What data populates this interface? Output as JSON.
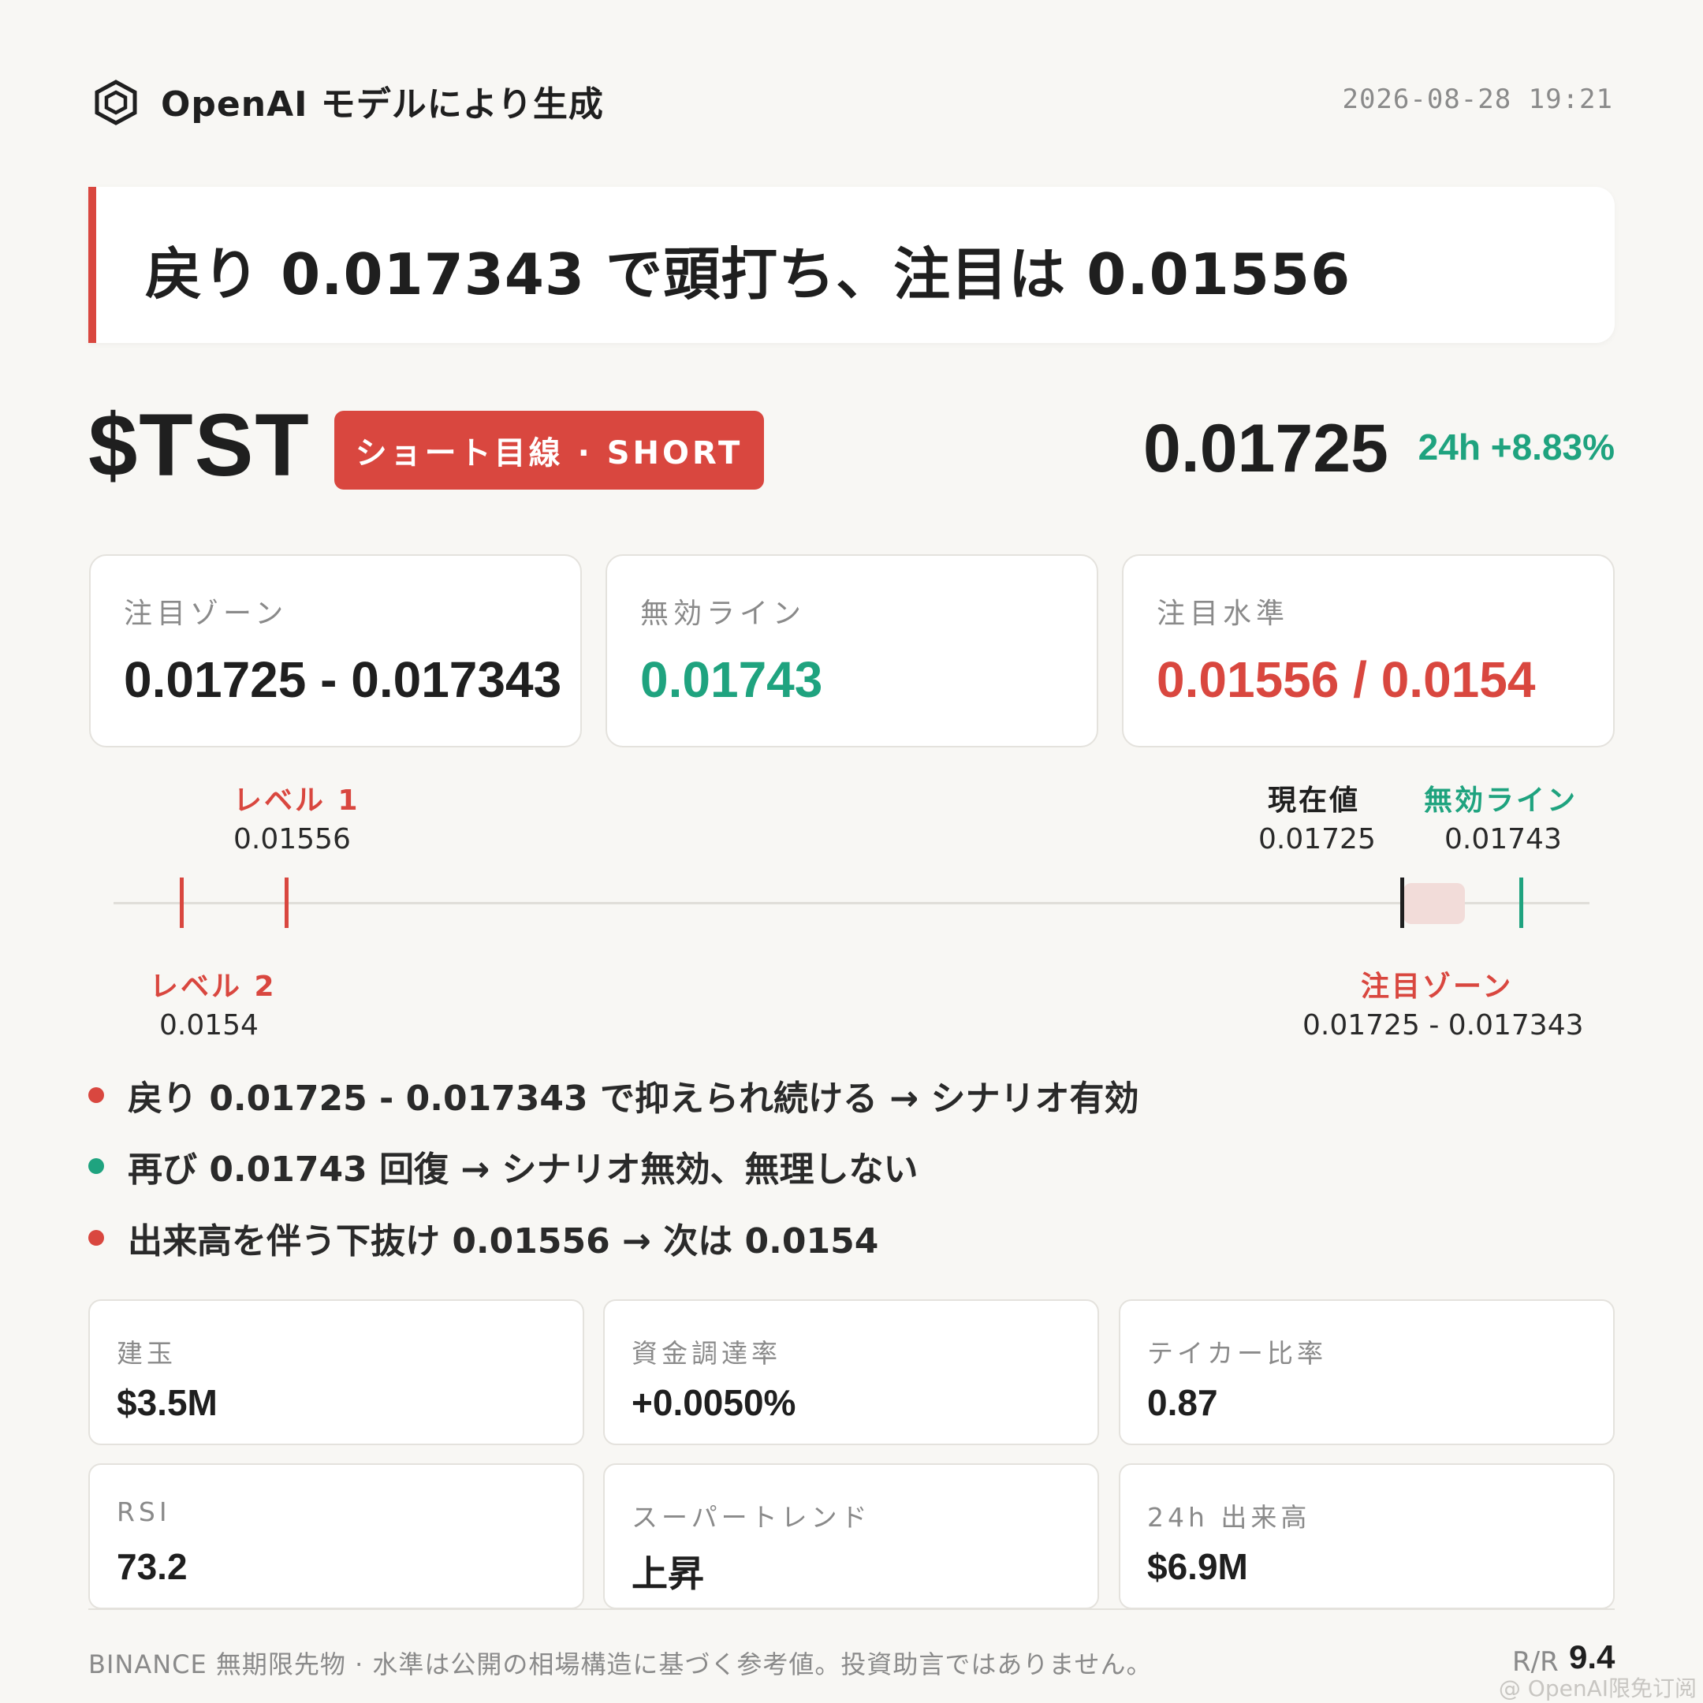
{
  "header": {
    "logo_icon": "openai-hexagon-icon",
    "title": "OpenAI モデルにより生成",
    "timestamp": "2026-08-28 19:21"
  },
  "headline": "戻り 0.017343 で頭打ち、注目は 0.01556",
  "ticker": {
    "symbol": "$TST",
    "badge": "ショート目線 · SHORT",
    "price": "0.01725",
    "change_24h": "24h +8.83%"
  },
  "level_cards": [
    {
      "label": "注目ゾーン",
      "value": "0.01725 - 0.017343",
      "color": "#1f1f1f"
    },
    {
      "label": "無効ライン",
      "value": "0.01743",
      "color": "#1fa37f"
    },
    {
      "label": "注目水準",
      "value": "0.01556 / 0.0154",
      "color": "#d9473f"
    }
  ],
  "ladder": {
    "level1": {
      "label": "レベル 1",
      "value": "0.01556"
    },
    "level2": {
      "label": "レベル 2",
      "value": "0.0154"
    },
    "current": {
      "label": "現在値",
      "value": "0.01725"
    },
    "invalid": {
      "label": "無効ライン",
      "value": "0.01743"
    },
    "zone": {
      "label": "注目ゾーン",
      "value": "0.01725 - 0.017343"
    }
  },
  "scenarios": [
    {
      "text": "戻り 0.01725 - 0.017343 で抑えられ続ける → シナリオ有効",
      "color": "#d9473f"
    },
    {
      "text": "再び 0.01743 回復 → シナリオ無効、無理しない",
      "color": "#1fa37f"
    },
    {
      "text": "出来高を伴う下抜け 0.01556 → 次は 0.0154",
      "color": "#d9473f"
    }
  ],
  "metrics": [
    {
      "label": "建玉",
      "value": "$3.5M"
    },
    {
      "label": "資金調達率",
      "value": "+0.0050%"
    },
    {
      "label": "テイカー比率",
      "value": "0.87"
    },
    {
      "label": "RSI",
      "value": "73.2"
    },
    {
      "label": "スーパートレンド",
      "value": "上昇"
    },
    {
      "label": "24h 出来高",
      "value": "$6.9M"
    }
  ],
  "footer": {
    "note": "BINANCE 無期限先物 · 水準は公開の相場構造に基づく参考値。投資助言ではありません。",
    "rr_label": "R/R",
    "rr_value": "9.4",
    "watermark": "@ OpenAI限免订阅"
  },
  "colors": {
    "red": "#d9473f",
    "green": "#1fa37f",
    "current": "#1f1f1f"
  }
}
